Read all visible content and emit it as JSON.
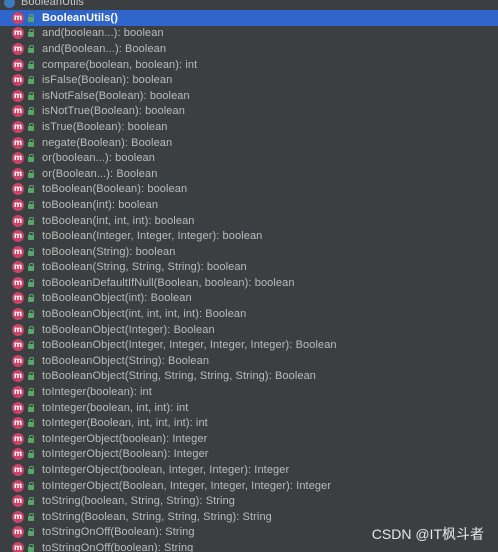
{
  "root": {
    "label": "BooleanUtils",
    "icon": "class-icon"
  },
  "members": [
    {
      "label": "BooleanUtils()",
      "selected": true
    },
    {
      "label": "and(boolean...): boolean"
    },
    {
      "label": "and(Boolean...): Boolean"
    },
    {
      "label": "compare(boolean, boolean): int"
    },
    {
      "label": "isFalse(Boolean): boolean"
    },
    {
      "label": "isNotFalse(Boolean): boolean"
    },
    {
      "label": "isNotTrue(Boolean): boolean"
    },
    {
      "label": "isTrue(Boolean): boolean"
    },
    {
      "label": "negate(Boolean): Boolean"
    },
    {
      "label": "or(boolean...): boolean"
    },
    {
      "label": "or(Boolean...): Boolean"
    },
    {
      "label": "toBoolean(Boolean): boolean"
    },
    {
      "label": "toBoolean(int): boolean"
    },
    {
      "label": "toBoolean(int, int, int): boolean"
    },
    {
      "label": "toBoolean(Integer, Integer, Integer): boolean"
    },
    {
      "label": "toBoolean(String): boolean"
    },
    {
      "label": "toBoolean(String, String, String): boolean"
    },
    {
      "label": "toBooleanDefaultIfNull(Boolean, boolean): boolean"
    },
    {
      "label": "toBooleanObject(int): Boolean"
    },
    {
      "label": "toBooleanObject(int, int, int, int): Boolean"
    },
    {
      "label": "toBooleanObject(Integer): Boolean"
    },
    {
      "label": "toBooleanObject(Integer, Integer, Integer, Integer): Boolean"
    },
    {
      "label": "toBooleanObject(String): Boolean"
    },
    {
      "label": "toBooleanObject(String, String, String, String): Boolean"
    },
    {
      "label": "toInteger(boolean): int"
    },
    {
      "label": "toInteger(boolean, int, int): int"
    },
    {
      "label": "toInteger(Boolean, int, int, int): int"
    },
    {
      "label": "toIntegerObject(boolean): Integer"
    },
    {
      "label": "toIntegerObject(Boolean): Integer"
    },
    {
      "label": "toIntegerObject(boolean, Integer, Integer): Integer"
    },
    {
      "label": "toIntegerObject(Boolean, Integer, Integer, Integer): Integer"
    },
    {
      "label": "toString(boolean, String, String): String"
    },
    {
      "label": "toString(Boolean, String, String, String): String"
    },
    {
      "label": "toStringOnOff(Boolean): String"
    },
    {
      "label": "toStringOnOff(boolean): String"
    }
  ],
  "method_icon_letter": "m",
  "watermark": "CSDN @IT枫斗者",
  "colors": {
    "background": "#3c3f41",
    "selection": "#2f65ca",
    "method_icon": "#c94466",
    "lock_icon": "#59a869",
    "text": "#bbbbbb"
  }
}
